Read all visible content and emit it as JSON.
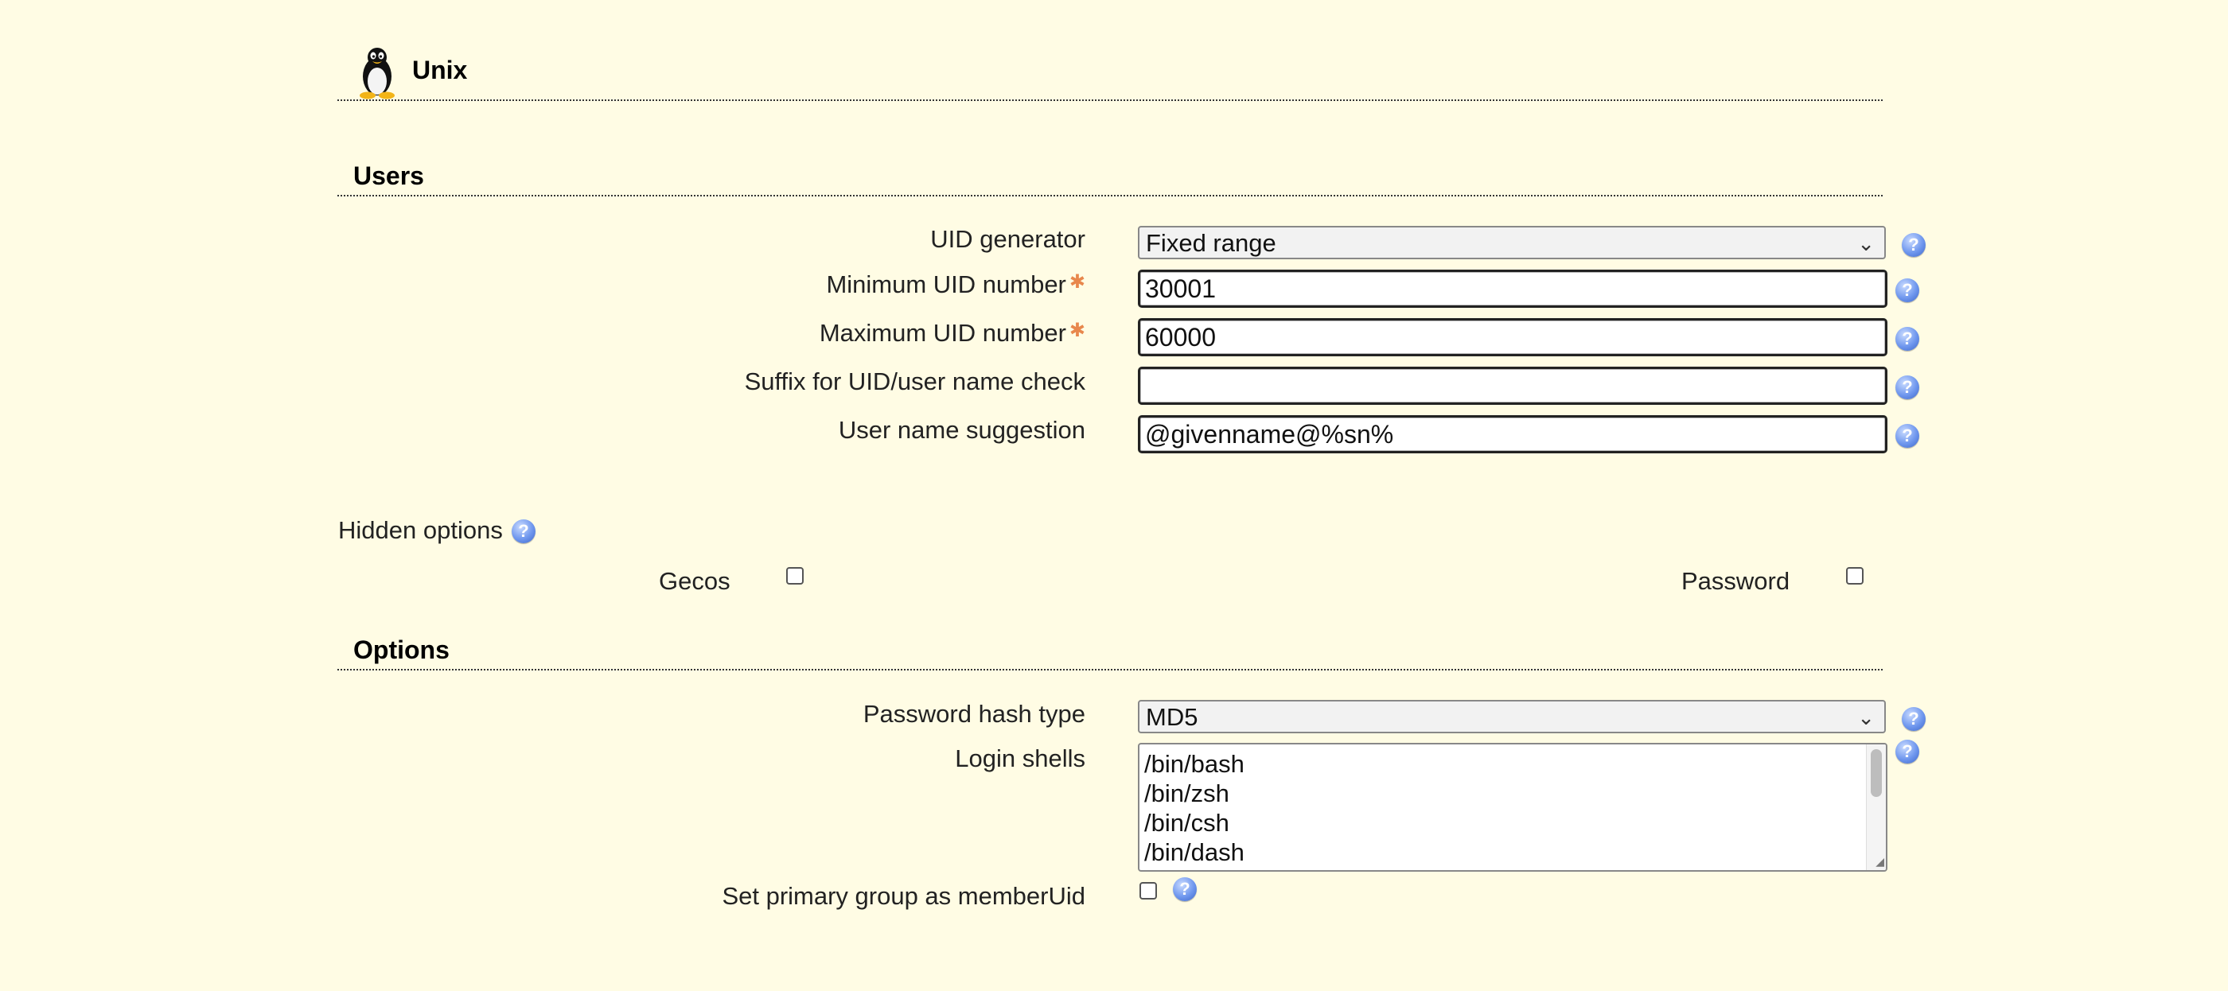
{
  "header": {
    "title": "Unix",
    "icon": "tux-penguin-icon"
  },
  "users": {
    "section_title": "Users",
    "uid_generator": {
      "label": "UID generator",
      "value": "Fixed range"
    },
    "min_uid": {
      "label": "Minimum UID number",
      "value": "30001",
      "required": true
    },
    "max_uid": {
      "label": "Maximum UID number",
      "value": "60000",
      "required": true
    },
    "suffix_check": {
      "label": "Suffix for UID/user name check",
      "value": ""
    },
    "username_suggestion": {
      "label": "User name suggestion",
      "value": "@givenname@%sn%"
    }
  },
  "hidden_options": {
    "title": "Hidden options",
    "gecos": {
      "label": "Gecos",
      "checked": false
    },
    "password": {
      "label": "Password",
      "checked": false
    }
  },
  "options": {
    "section_title": "Options",
    "hash_type": {
      "label": "Password hash type",
      "value": "MD5"
    },
    "login_shells": {
      "label": "Login shells",
      "items": [
        "/bin/bash",
        "/bin/zsh",
        "/bin/csh",
        "/bin/dash"
      ]
    },
    "primary_group": {
      "label": "Set primary group as memberUid",
      "checked": false
    }
  },
  "colors": {
    "background": "#fffce4",
    "required_star": "#e8874c",
    "help_icon": "#6f97ee"
  }
}
